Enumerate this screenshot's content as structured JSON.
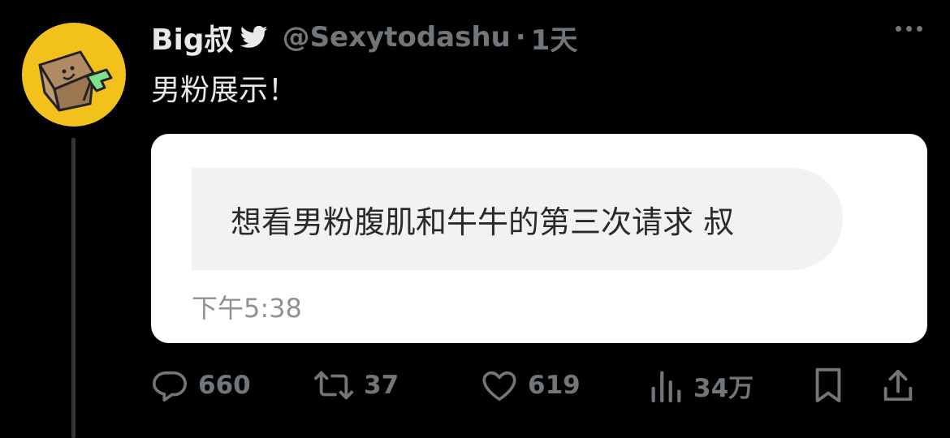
{
  "tweet": {
    "author_name": "Big叔",
    "handle": "@Sexytodashu",
    "separator": "·",
    "time_ago": "1天",
    "text": "男粉展示！"
  },
  "media": {
    "message_text": "想看男粉腹肌和牛牛的第三次请求 叔",
    "message_time": "下午5:38"
  },
  "actions": {
    "replies": "660",
    "retweets": "37",
    "likes": "619",
    "views": "34万"
  },
  "colors": {
    "background": "#000000",
    "text_primary": "#e7e9ea",
    "text_secondary": "#71767b",
    "avatar_bg": "#f2c11b",
    "card_bg": "#ffffff",
    "bubble_bg": "#f0f2f4"
  },
  "icons": [
    "twitter-bird-icon",
    "more-icon",
    "reply-icon",
    "retweet-icon",
    "like-icon",
    "views-icon",
    "bookmark-icon",
    "share-icon"
  ]
}
